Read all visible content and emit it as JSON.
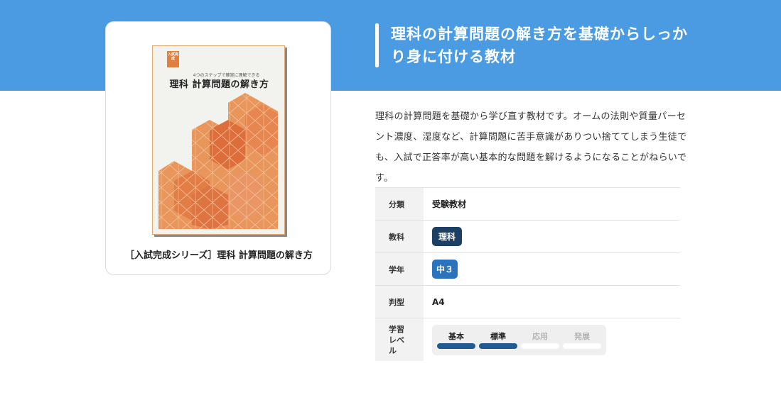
{
  "hero": {
    "title": "理科の計算問題の解き方を基礎からしっかり身に付ける教材"
  },
  "product": {
    "caption": "［入試完成シリーズ］理科 計算問題の解き方",
    "cover": {
      "badge": "入試完成",
      "subtitle": "4つのステップで確実に理解できる",
      "title": "理科 計算問題の解き方",
      "accent_color": "#e0803e"
    }
  },
  "description": "理科の計算問題を基礎から学び直す教材です。オームの法則や質量パーセント濃度、湿度など、計算問題に苦手意識がありつい捨ててしまう生徒でも、入試で正答率が高い基本的な問題を解けるようになることがねらいです。",
  "spec": {
    "rows": [
      {
        "label": "分類",
        "value": "受験教材"
      },
      {
        "label": "教科",
        "value": "理科",
        "color": "#1c3f64"
      },
      {
        "label": "学年",
        "value": "中３",
        "color": "#2b74bd"
      },
      {
        "label": "判型",
        "value": "A4"
      }
    ],
    "level": {
      "label": "学習レベル",
      "items": [
        {
          "name": "基本",
          "active": true
        },
        {
          "name": "標準",
          "active": true
        },
        {
          "name": "応用",
          "active": false
        },
        {
          "name": "発展",
          "active": false
        }
      ],
      "active_color": "#1f5a93"
    }
  },
  "colors": {
    "header": "#4a9be2",
    "background": "#ffffff"
  }
}
